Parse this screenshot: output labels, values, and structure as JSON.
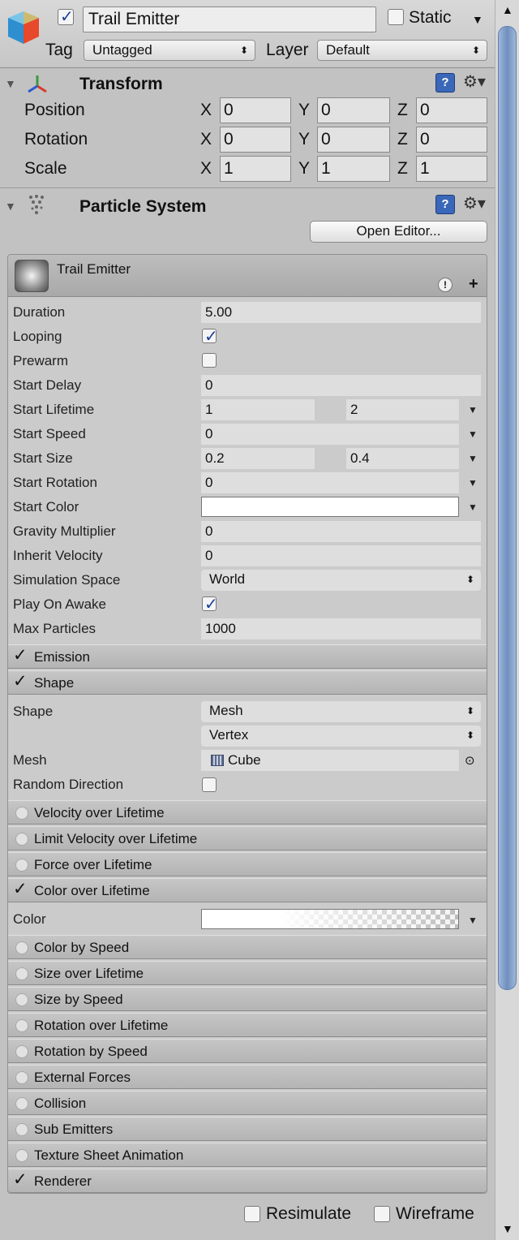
{
  "header": {
    "object_name": "Trail Emitter",
    "active_checked": true,
    "static_label": "Static",
    "tag_label": "Tag",
    "tag_value": "Untagged",
    "layer_label": "Layer",
    "layer_value": "Default"
  },
  "transform": {
    "title": "Transform",
    "rows": [
      {
        "label": "Position",
        "x": "0",
        "y": "0",
        "z": "0"
      },
      {
        "label": "Rotation",
        "x": "0",
        "y": "0",
        "z": "0"
      },
      {
        "label": "Scale",
        "x": "1",
        "y": "1",
        "z": "1"
      }
    ],
    "axis_x": "X",
    "axis_y": "Y",
    "axis_z": "Z"
  },
  "particle_system": {
    "title": "Particle System",
    "open_editor": "Open Editor...",
    "emitter_name": "Trail Emitter",
    "props": {
      "duration": {
        "label": "Duration",
        "value": "5.00"
      },
      "looping": {
        "label": "Looping",
        "checked": true
      },
      "prewarm": {
        "label": "Prewarm",
        "checked": false
      },
      "start_delay": {
        "label": "Start Delay",
        "value": "0"
      },
      "start_lifetime": {
        "label": "Start Lifetime",
        "min": "1",
        "max": "2"
      },
      "start_speed": {
        "label": "Start Speed",
        "value": "0"
      },
      "start_size": {
        "label": "Start Size",
        "min": "0.2",
        "max": "0.4"
      },
      "start_rotation": {
        "label": "Start Rotation",
        "value": "0"
      },
      "start_color": {
        "label": "Start Color",
        "color": "#ffffff"
      },
      "gravity": {
        "label": "Gravity Multiplier",
        "value": "0"
      },
      "inherit_velocity": {
        "label": "Inherit Velocity",
        "value": "0"
      },
      "simulation_space": {
        "label": "Simulation Space",
        "value": "World"
      },
      "play_on_awake": {
        "label": "Play On Awake",
        "checked": true
      },
      "max_particles": {
        "label": "Max Particles",
        "value": "1000"
      }
    },
    "emission": "Emission",
    "shape_module": "Shape",
    "shape": {
      "label": "Shape",
      "value": "Mesh",
      "sub_value": "Vertex"
    },
    "mesh": {
      "label": "Mesh",
      "value": "Cube"
    },
    "random_direction": {
      "label": "Random Direction",
      "checked": false
    },
    "modules_a": [
      "Velocity over Lifetime",
      "Limit Velocity over Lifetime",
      "Force over Lifetime"
    ],
    "color_over_lifetime": "Color over Lifetime",
    "color_label": "Color",
    "modules_b": [
      "Color by Speed",
      "Size over Lifetime",
      "Size by Speed",
      "Rotation over Lifetime",
      "Rotation by Speed",
      "External Forces",
      "Collision",
      "Sub Emitters",
      "Texture Sheet Animation"
    ],
    "renderer": "Renderer"
  },
  "footer": {
    "resimulate": "Resimulate",
    "wireframe": "Wireframe"
  },
  "icons": {
    "gameobject": "gameobject-cube-icon",
    "transform": "transform-axes-icon",
    "particles": "particle-system-icon",
    "help": "help-book-icon",
    "gear": "gear-icon"
  }
}
